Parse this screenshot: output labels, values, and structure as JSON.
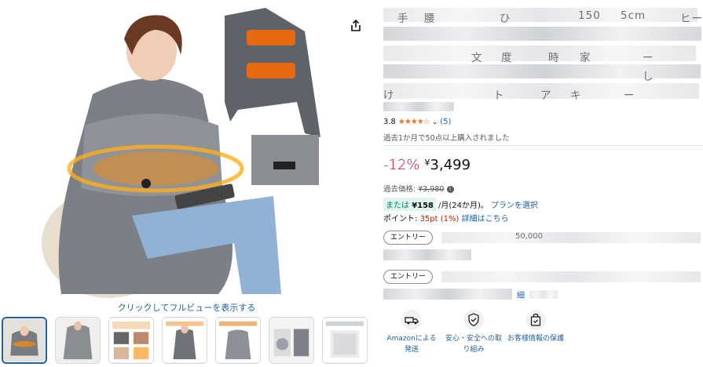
{
  "gallery": {
    "full_view_label": "クリックしてフルビューを表示する",
    "thumbnail_count": 7
  },
  "product": {
    "title_fragments": [
      "手",
      "腰",
      "ひ",
      "150",
      "5cm",
      "ヒー",
      "文",
      "度",
      "時",
      "家",
      "ー",
      "し",
      "け",
      "ト",
      "ア",
      "キ",
      "ー"
    ],
    "rating": "3.8",
    "rating_count": "(5)",
    "bought_text": "過去1か月で50点以上購入されました",
    "discount": "-12%",
    "price_symbol": "¥",
    "price": "3,499",
    "ref_price_label": "過去価格:",
    "ref_price": "¥3,980",
    "installment_prefix": "または",
    "installment_amount": "¥158",
    "installment_suffix": "/月(24か月)。",
    "installment_link": "プランを選択",
    "points_label": "ポイント:",
    "points_value": "35pt (1%)",
    "points_link": "詳細はこちら",
    "entry_label_1": "エントリー",
    "entry_text_1": "50,000",
    "entry_label_2": "エントリー",
    "entry_link_2": "細",
    "features": [
      {
        "label": "Amazonによる発送",
        "icon": "truck-icon"
      },
      {
        "label": "安心・安全への取り組み",
        "icon": "shield-check-icon"
      },
      {
        "label": "お客様情報の保護",
        "icon": "bag-check-icon"
      }
    ]
  },
  "colors": {
    "link": "#2162a1",
    "discount": "#cc0c39",
    "star": "#de7921",
    "installment_bg": "#dff5ee"
  }
}
